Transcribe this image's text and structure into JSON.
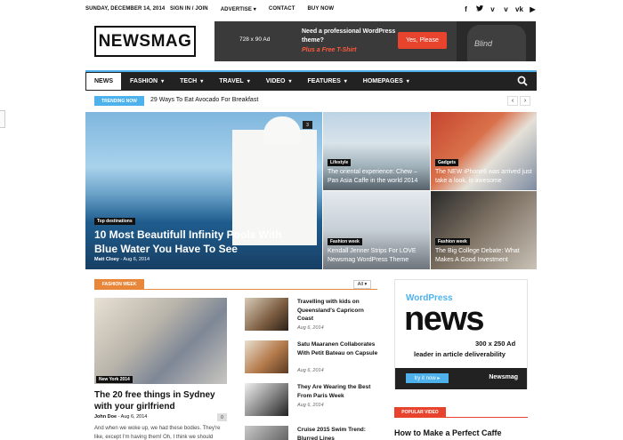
{
  "topbar": {
    "date": "SUNDAY, DECEMBER 14, 2014",
    "menu": [
      "SIGN IN / JOIN",
      "ADVERTISE",
      "CONTACT",
      "BUY NOW"
    ],
    "advertise_caret": "▾",
    "social": [
      "f",
      "t",
      "v",
      "v",
      "vk",
      "▶"
    ]
  },
  "logo": "NEWSMAG",
  "ad_banner": {
    "size": "728 x 90 Ad",
    "line1": "Need a professional WordPress theme?",
    "line2": "Plus a Free T-Shirt",
    "button": "Yes, Please",
    "shirt_text": "Blind"
  },
  "nav": {
    "items": [
      "NEWS",
      "FASHION",
      "TECH",
      "TRAVEL",
      "VIDEO",
      "FEATURES",
      "HOMEPAGES"
    ],
    "caret": "▾"
  },
  "trending": {
    "tag": "TRENDING NOW",
    "text": "29 Ways To Eat Avocado For Breakfast",
    "prev": "‹",
    "next": "›"
  },
  "grid": {
    "big": {
      "category": "Top destinations",
      "title": "10 Most Beautifull Infinity Pools With Blue Water You Have To See",
      "author": "Matt Cloey",
      "date": "Aug 6, 2014",
      "comments": "3"
    },
    "small": [
      {
        "category": "Lifestyle",
        "title": "The oriental experience: Chew – Pan Asia Caffe in the world 2014"
      },
      {
        "category": "Gadgets",
        "title": "The NEW iPhone6 was arrived just take a look, is awesome"
      },
      {
        "category": "Fashion week",
        "title": "Kendall Jenner Strips For LOVE Newsmag WordPress Theme"
      },
      {
        "category": "Fashion week",
        "title": "The Big College Debate: What Makes A Good Investment"
      }
    ]
  },
  "section": {
    "tag": "FASHION WEEK",
    "filter": "All",
    "filter_caret": "▾",
    "featured": {
      "category": "New York 2014",
      "title": "The 20 free things in Sydney with your girlfriend",
      "author": "John Doe",
      "date": "Aug 6, 2014",
      "comments": "0",
      "excerpt": "And when we woke up, we had these bodies. They're like, except I'm having them! Oh, I think we should"
    },
    "list": [
      {
        "title": "Travelling with kids on Queensland's Capricorn Coast",
        "date": "Aug 6, 2014"
      },
      {
        "title": "Satu Maaranen Collaborates With Petit Bateau on Capsule",
        "date": "Aug 6, 2014"
      },
      {
        "title": "They Are Wearing the Best From Paris Week",
        "date": "Aug 6, 2014"
      },
      {
        "title": "Cruise 2015 Swim Trend: Blurred Lines",
        "date": ""
      }
    ]
  },
  "sidebar_ad": {
    "wordpress": "WordPress",
    "news": "news",
    "size": "300 x 250 Ad",
    "lead": "leader in article deliverability",
    "try": "try it now",
    "try_arrow": "▸",
    "brand": "Newsmag"
  },
  "popular": {
    "tag": "POPULAR VIDEO",
    "title": "How to Make a Perfect Caffe"
  }
}
